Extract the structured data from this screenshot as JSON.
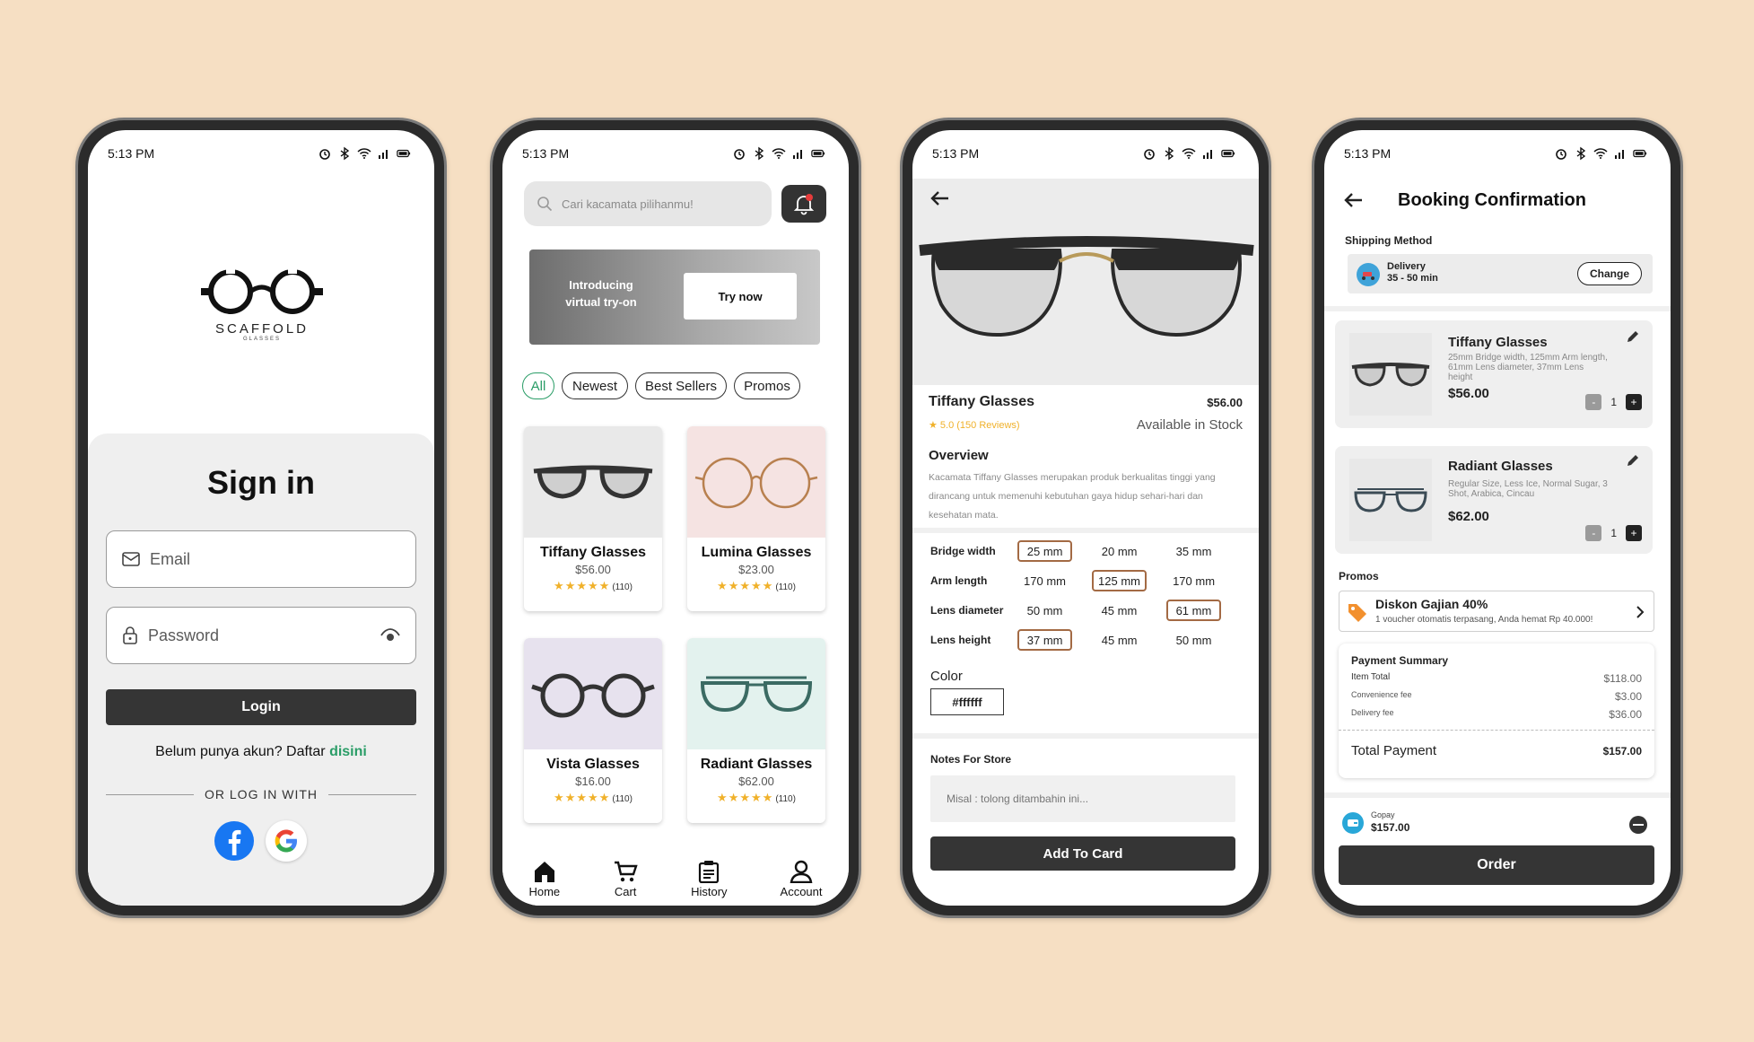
{
  "status_time": "5:13 PM",
  "signin": {
    "brand": "SCAFFOLD",
    "brand_sub": "GLASSES",
    "title": "Sign in",
    "email_placeholder": "Email",
    "password_placeholder": "Password",
    "login_label": "Login",
    "register_prompt": "Belum punya akun? Daftar",
    "register_link": "disini",
    "divider_text": "OR LOG IN WITH"
  },
  "home": {
    "search_placeholder": "Cari kacamata pilihanmu!",
    "banner_text_1": "Introducing",
    "banner_text_2": "virtual try-on",
    "banner_button": "Try now",
    "chips": [
      "All",
      "Newest",
      "Best Sellers",
      "Promos"
    ],
    "products": [
      {
        "name": "Tiffany Glasses",
        "price": "$56.00",
        "stars": "★★★★★",
        "count": "(110)",
        "bg": "#e9e9e9"
      },
      {
        "name": "Lumina Glasses",
        "price": "$23.00",
        "stars": "★★★★★",
        "count": "(110)",
        "bg": "#f5e3e2"
      },
      {
        "name": "Vista Glasses",
        "price": "$16.00",
        "stars": "★★★★★",
        "count": "(110)",
        "bg": "#e7e2ee"
      },
      {
        "name": "Radiant Glasses",
        "price": "$62.00",
        "stars": "★★★★★",
        "count": "(110)",
        "bg": "#e3f2ee"
      }
    ],
    "nav": [
      "Home",
      "Cart",
      "History",
      "Account"
    ]
  },
  "detail": {
    "name": "Tiffany Glasses",
    "price": "$56.00",
    "rating": "★ 5.0 (150 Reviews)",
    "stock": "Available in Stock",
    "overview_title": "Overview",
    "overview_text": "Kacamata Tiffany Glasses merupakan produk berkualitas tinggi yang dirancang untuk memenuhi kebutuhan gaya hidup sehari-hari dan kesehatan mata.",
    "sizes": [
      {
        "label": "Bridge width",
        "options": [
          "25 mm",
          "20 mm",
          "35 mm"
        ],
        "selected": 0
      },
      {
        "label": "Arm length",
        "options": [
          "170 mm",
          "125 mm",
          "170 mm"
        ],
        "selected": 1
      },
      {
        "label": "Lens diameter",
        "options": [
          "50 mm",
          "45 mm",
          "61 mm"
        ],
        "selected": 2
      },
      {
        "label": "Lens height",
        "options": [
          "37 mm",
          "45 mm",
          "50 mm"
        ],
        "selected": 0
      }
    ],
    "color_title": "Color",
    "color_value": "#ffffff",
    "notes_title": "Notes For Store",
    "notes_placeholder": "Misal : tolong ditambahin ini...",
    "add_button": "Add To Card"
  },
  "booking": {
    "title": "Booking Confirmation",
    "shipping_title": "Shipping Method",
    "shipping_name": "Delivery",
    "shipping_time": "35 - 50 min",
    "change_label": "Change",
    "items": [
      {
        "name": "Tiffany Glasses",
        "desc": "25mm Bridge width, 125mm Arm length, 61mm Lens diameter, 37mm Lens height",
        "price": "$56.00",
        "qty": "1"
      },
      {
        "name": "Radiant Glasses",
        "desc": "Regular Size, Less Ice, Normal Sugar, 3 Shot, Arabica, Cincau",
        "price": "$62.00",
        "qty": "1"
      }
    ],
    "promos_title": "Promos",
    "promo_name": "Diskon Gajian 40%",
    "promo_desc": "1 voucher otomatis terpasang, Anda hemat Rp 40.000!",
    "summary_title": "Payment Summary",
    "summary": [
      {
        "label": "Item Total",
        "value": "$118.00"
      },
      {
        "label": "Convenience fee",
        "value": "$3.00"
      },
      {
        "label": "Delivery fee",
        "value": "$36.00"
      }
    ],
    "total_label": "Total Payment",
    "total_value": "$157.00",
    "pay_method": "Gopay",
    "pay_amount": "$157.00",
    "order_label": "Order"
  }
}
